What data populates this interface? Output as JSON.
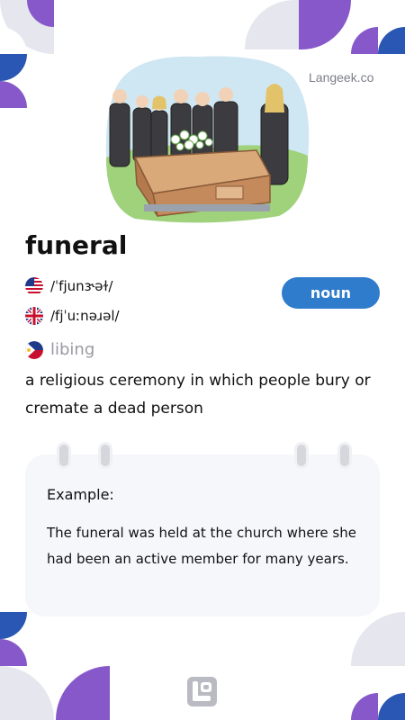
{
  "brand": "Langeek.co",
  "word": "funeral",
  "pronunciations": {
    "us": {
      "flag": "us-flag-icon",
      "text": "/ˈfjunɝəɫ/"
    },
    "uk": {
      "flag": "uk-flag-icon",
      "text": "/fjˈuːnəɹəl/"
    }
  },
  "part_of_speech": "noun",
  "translation": {
    "flag": "philippines-flag-icon",
    "text": "libing"
  },
  "definition": "a religious ceremony in which people bury or cremate a dead person",
  "example": {
    "label": "Example:",
    "text": "The funeral was held at the church where she had been an active member for many years."
  },
  "colors": {
    "accent_blue": "#2f7ccc",
    "purple": "#8758c9",
    "dark_blue": "#2a57b3",
    "grey": "#e6e7ee",
    "card_bg": "#f6f7fb"
  },
  "icons": {
    "illustration": "funeral-illustration",
    "logo": "langeek-logo-icon"
  }
}
